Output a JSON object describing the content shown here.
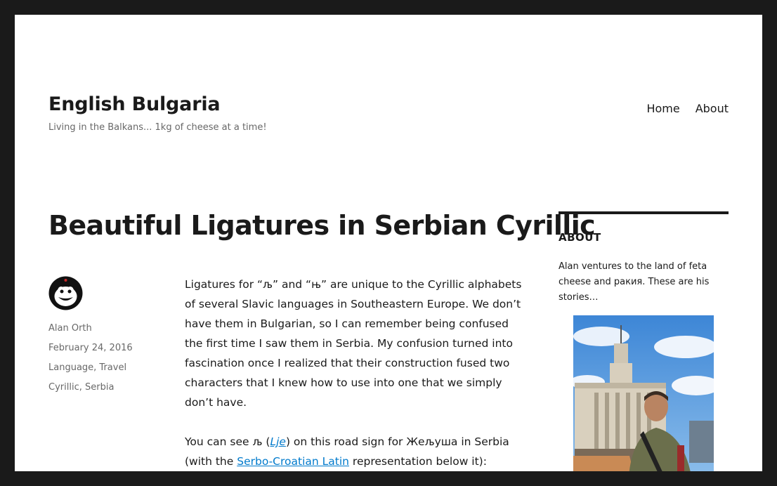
{
  "site": {
    "title": "English Bulgaria",
    "description": "Living in the Balkans... 1kg of cheese at a time!"
  },
  "nav": {
    "home": "Home",
    "about": "About"
  },
  "post": {
    "title": "Beautiful Ligatures in Serbian Cyrillic",
    "author": "Alan Orth",
    "date": "February 24, 2016",
    "categories": {
      "language": "Language",
      "separator": ", ",
      "travel": "Travel"
    },
    "tags": {
      "cyrillic": "Cyrillic",
      "separator": ", ",
      "serbia": "Serbia"
    },
    "paragraph1": "Ligatures for “љ” and “њ” are unique to the Cyrillic alphabets of several Slavic languages in Southeastern Europe. We don’t have them in Bulgarian, so I can remember being confused the first time I saw them in Serbia. My confusion turned into fascination once I realized that their construction fused two characters that I knew how to use into one that we simply don’t have.",
    "paragraph2": {
      "part1": "You can see љ (",
      "link1": "Lje",
      "part2": ") on this road sign for Жељуша in Serbia (with the ",
      "link2": "Serbo-Croatian Latin",
      "part3": " representation below it):"
    }
  },
  "sidebar": {
    "widget_title": "ABOUT",
    "widget_text": "Alan ventures to the land of feta cheese and ракия. These are his stories…"
  },
  "colors": {
    "frame": "#1a1a1a",
    "link": "#007acc",
    "meta": "#686868"
  },
  "icons": {
    "avatar": "penguin-avatar-icon",
    "photo": "about-photo"
  }
}
